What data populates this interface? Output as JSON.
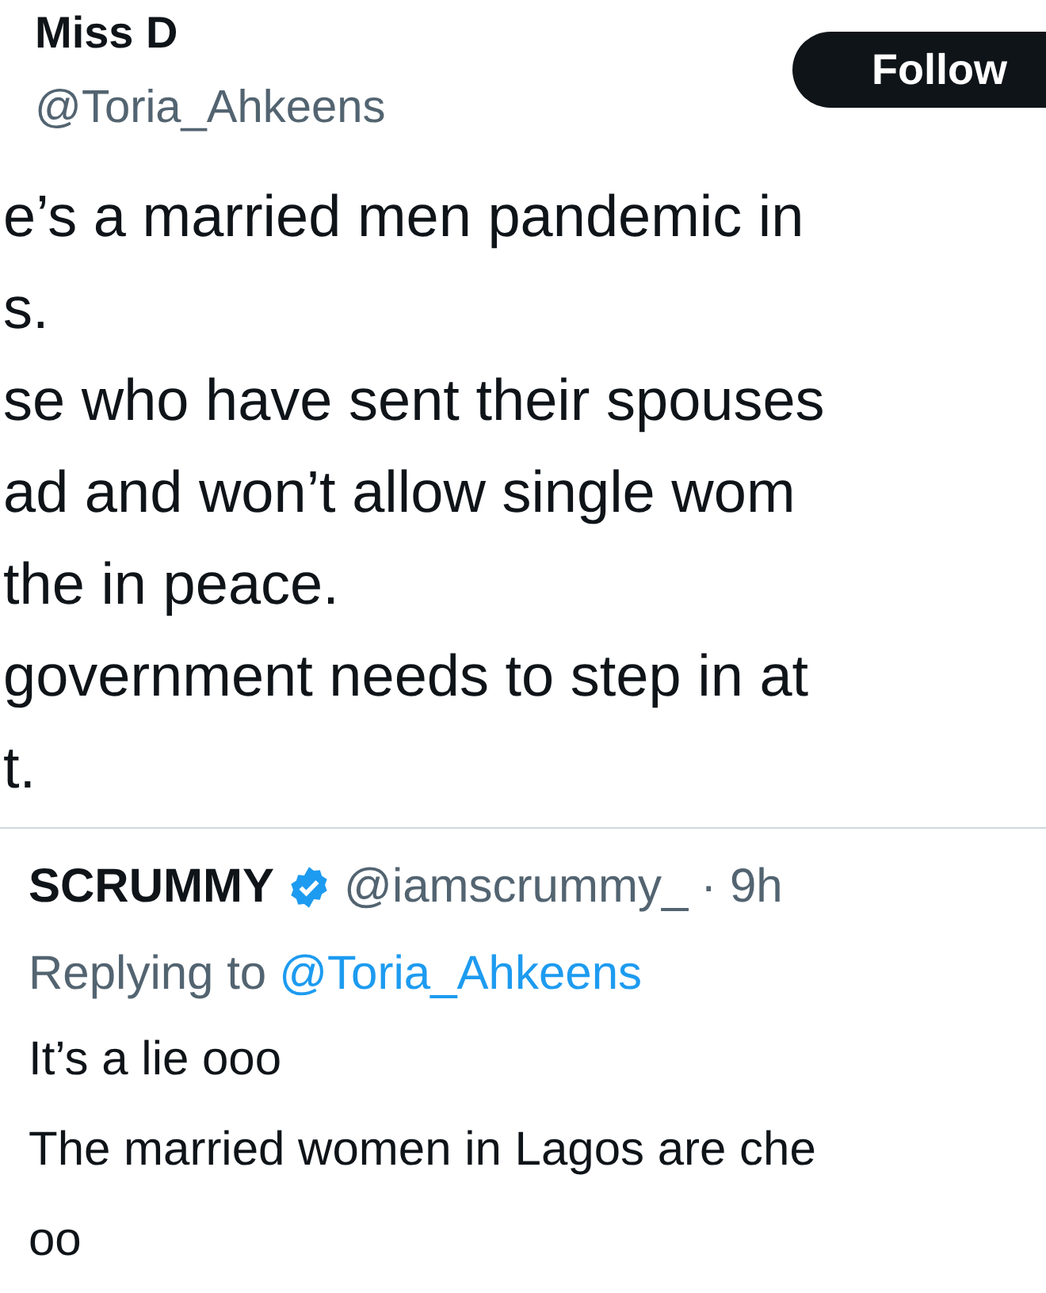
{
  "author": {
    "name": "Miss D",
    "handle": "@Toria_Ahkeens"
  },
  "follow_button": "Follow",
  "tweet_lines": [
    "e’s a married men pandemic in",
    "s.",
    "se who have sent their spouses",
    "ad and won’t allow single wom",
    "the in peace.",
    "government needs to step in at",
    "t."
  ],
  "reply": {
    "name": "SCRUMMY",
    "verified": true,
    "handle": "@iamscrummy_",
    "time": "· 9h",
    "replying_label": "Replying to",
    "replying_to": "@Toria_Ahkeens",
    "lines": [
      "It’s a lie ooo",
      "The married women in Lagos are che",
      "oo"
    ]
  }
}
